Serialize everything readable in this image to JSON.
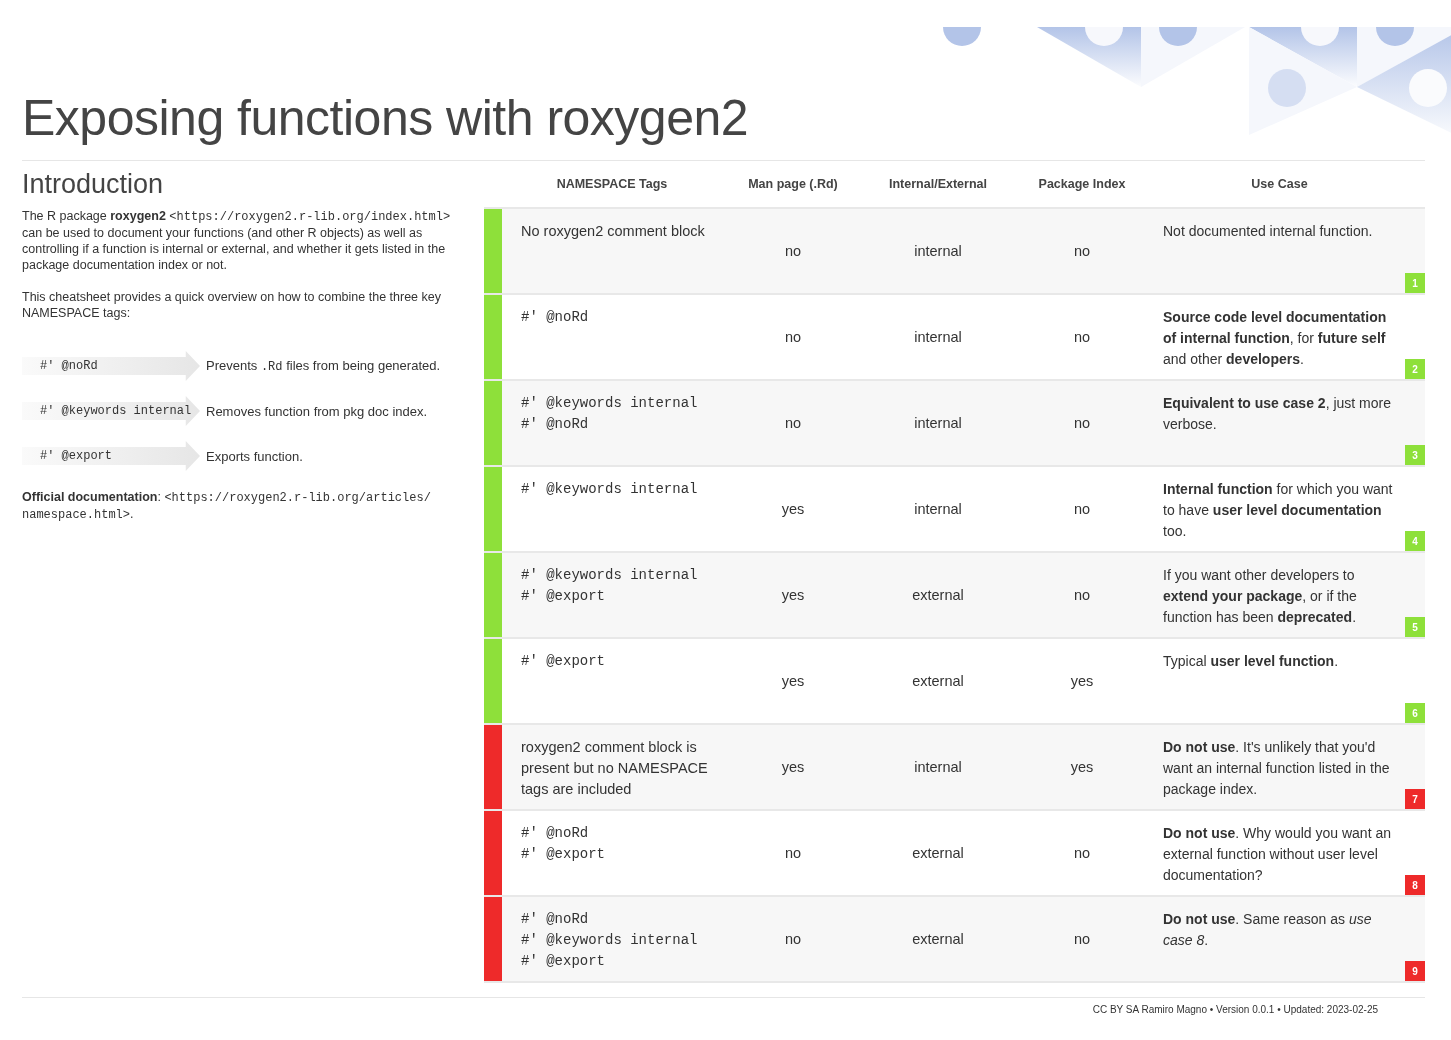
{
  "title": "Exposing functions with roxygen2",
  "intro": {
    "heading": "Introduction",
    "paragraphs": [
      [
        {
          "kind": "text",
          "text": "The R package **roxygen2** "
        },
        {
          "kind": "code",
          "text": "<https://roxygen2.r-lib.org/index.html>"
        },
        {
          "kind": "text",
          "text": " can be used to document your functions (and other R objects) as well as controlling if a function is internal or external, and whether it gets listed in the package documentation index or not."
        }
      ],
      [
        {
          "kind": "text",
          "text": "This cheatsheet provides a quick overview on how to combine the three key NAMESPACE tags:"
        }
      ]
    ],
    "tags": [
      {
        "tag": "#' @noRd",
        "description": [
          {
            "kind": "text",
            "text": "Prevents "
          },
          {
            "kind": "code",
            "text": ".Rd"
          },
          {
            "kind": "text",
            "text": " files from being generated."
          }
        ]
      },
      {
        "tag": "#' @keywords internal",
        "description": [
          {
            "kind": "text",
            "text": "Removes function from pkg doc index."
          }
        ]
      },
      {
        "tag": "#' @export",
        "description": [
          {
            "kind": "text",
            "text": "Exports function."
          }
        ]
      }
    ],
    "official": [
      {
        "kind": "text",
        "text": "**Official documentation**: "
      },
      {
        "kind": "code",
        "text": "<https://roxygen2.r-lib.org/articles/ namespace.html>"
      },
      {
        "kind": "text",
        "text": "."
      }
    ]
  },
  "table": {
    "columns": [
      "NAMESPACE Tags",
      "Man page (.Rd)",
      "Internal/External",
      "Package Index",
      "Use Case"
    ],
    "rows": [
      {
        "color": "#8ee03a",
        "kind": "text",
        "tags": [
          "No roxygen2 comment block"
        ],
        "man_page": "no",
        "visibility": "internal",
        "package_index": "no",
        "use_case": "Not documented internal function.",
        "badge": "1"
      },
      {
        "color": "#8ee03a",
        "kind": "code",
        "tags": [
          "#' @noRd"
        ],
        "man_page": "no",
        "visibility": "internal",
        "package_index": "no",
        "use_case": "**Source code level documentation of internal function**, for **future self** and other **developers**.",
        "badge": "2"
      },
      {
        "color": "#8ee03a",
        "kind": "code",
        "tags": [
          "#' @keywords internal",
          "#' @noRd"
        ],
        "man_page": "no",
        "visibility": "internal",
        "package_index": "no",
        "use_case": "**Equivalent to use case 2**, just more verbose.",
        "badge": "3"
      },
      {
        "color": "#8ee03a",
        "kind": "code",
        "tags": [
          "#' @keywords internal"
        ],
        "man_page": "yes",
        "visibility": "internal",
        "package_index": "no",
        "use_case": "**Internal function** for which you want to have **user level documentation** too.",
        "badge": "4"
      },
      {
        "color": "#8ee03a",
        "kind": "code",
        "tags": [
          "#' @keywords internal",
          "#' @export"
        ],
        "man_page": "yes",
        "visibility": "external",
        "package_index": "no",
        "use_case": "If you want other developers to **extend your package**, or if the function has been **deprecated**.",
        "badge": "5"
      },
      {
        "color": "#8ee03a",
        "kind": "code",
        "tags": [
          "#' @export"
        ],
        "man_page": "yes",
        "visibility": "external",
        "package_index": "yes",
        "use_case": "Typical **user level function**.",
        "badge": "6"
      },
      {
        "color": "#ee2a2a",
        "kind": "text",
        "tags": [
          "roxygen2 comment block is present but no NAMESPACE tags are included"
        ],
        "man_page": "yes",
        "visibility": "internal",
        "package_index": "yes",
        "use_case": "**Do not use**. It's unlikely that you'd want an internal function listed in the package index.",
        "badge": "7"
      },
      {
        "color": "#ee2a2a",
        "kind": "code",
        "tags": [
          "#' @noRd",
          "#' @export"
        ],
        "man_page": "no",
        "visibility": "external",
        "package_index": "no",
        "use_case": "**Do not use**. Why would you want an external function without user level documentation?",
        "badge": "8"
      },
      {
        "color": "#ee2a2a",
        "kind": "code",
        "tags": [
          "#' @noRd",
          "#' @keywords internal",
          "#' @export"
        ],
        "man_page": "no",
        "visibility": "external",
        "package_index": "no",
        "use_case": "**Do not use**. Same reason as *use case 8*.",
        "badge": "9"
      }
    ]
  },
  "footer": "CC BY SA Ramiro Magno • Version 0.0.1 • Updated: 2023-02-25"
}
